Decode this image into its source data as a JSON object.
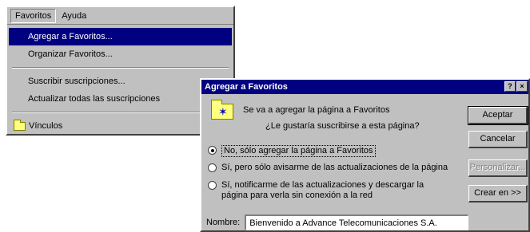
{
  "menu": {
    "bar_items": [
      {
        "label": "Favoritos"
      },
      {
        "label": "Ayuda"
      }
    ],
    "items": [
      {
        "label": "Agregar a Favoritos..."
      },
      {
        "label": "Organizar Favoritos..."
      },
      {
        "label": "Suscribir suscripciones..."
      },
      {
        "label": "Actualizar todas las suscripciones"
      },
      {
        "label": "Vínculos"
      }
    ],
    "highlight_color": "#000080"
  },
  "dialog": {
    "title": "Agregar a Favoritos",
    "title_buttons": {
      "help": "?",
      "close": "×"
    },
    "message": "Se va a agregar la página a Favoritos",
    "question": "¿Le gustaría suscribirse a esta página?",
    "options": [
      {
        "label": "No, sólo agregar la página a Favoritos",
        "selected": true
      },
      {
        "label": "Sí, pero sólo avisarme de las actualizaciones de la página",
        "selected": false
      },
      {
        "label": "Sí, notificarme de las actualizaciones y descargar la página para verla sin conexión a la red",
        "selected": false
      }
    ],
    "name_label": "Nombre:",
    "name_value": "Bienvenido a Advance Telecomunicaciones S.A.",
    "buttons": {
      "accept": "Aceptar",
      "cancel": "Cancelar",
      "customize": "Personalizar...",
      "create_in": "Crear en >>"
    },
    "title_color": "#000080",
    "face_color": "#c0c0c0"
  }
}
